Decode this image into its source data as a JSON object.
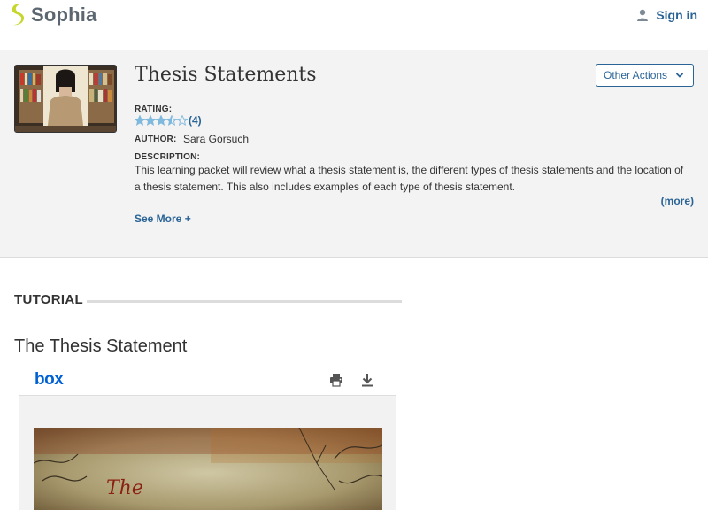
{
  "header": {
    "brand": "Sophia",
    "brand_color": "#c6d62a",
    "signin_label": "Sign in"
  },
  "resource": {
    "title": "Thesis Statements",
    "other_actions_label": "Other Actions",
    "rating_label": "RATING:",
    "rating_stars": 3.5,
    "rating_count": "(4)",
    "author_label": "AUTHOR:",
    "author": "Sara Gorsuch",
    "description_label": "DESCRIPTION:",
    "description": "This learning packet will review what a thesis statement is, the different types of thesis statements and the location of a thesis statement. This also includes examples of each type of thesis statement.",
    "more_label": "(more)",
    "see_more_label": "See More +"
  },
  "tutorial": {
    "section_label": "TUTORIAL",
    "title": "The Thesis Statement"
  },
  "viewer": {
    "brand": "box",
    "doc_title_fragment": "The",
    "icons": [
      "print-icon",
      "download-icon"
    ]
  },
  "colors": {
    "link": "#2a6496",
    "banner_bg": "#f3f3f3",
    "star": "#7fb9de",
    "box_blue": "#0061d5"
  }
}
